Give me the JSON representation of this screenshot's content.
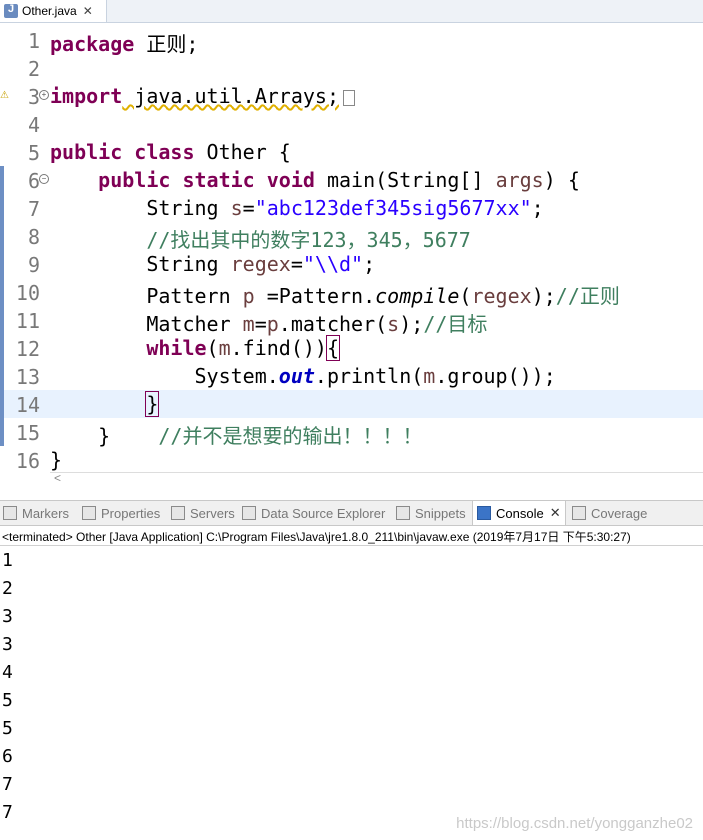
{
  "editor_tab": {
    "title": "Other.java",
    "close": "✕"
  },
  "code": {
    "l1_kw": "package",
    "l1_rest": " 正则;",
    "l3_kw": "import",
    "l3_rest": " java.util.Arrays;",
    "l5_kw1": "public",
    "l5_kw2": "class",
    "l5_rest": " Other {",
    "l6_kw1": "public",
    "l6_kw2": "static",
    "l6_kw3": "void",
    "l6_a": " main(String[] ",
    "l6_var": "args",
    "l6_b": ") {",
    "l7_a": "String ",
    "l7_var": "s",
    "l7_b": "=",
    "l7_str": "\"abc123def345sig5677xx\"",
    "l7_c": ";",
    "l8_cm": "//找出其中的数字123，345，5677",
    "l9_a": "String ",
    "l9_var": "regex",
    "l9_b": "=",
    "l9_str": "\"\\\\d\"",
    "l9_c": ";",
    "l10_a": "Pattern ",
    "l10_var": "p",
    "l10_b": " =Pattern.",
    "l10_it": "compile",
    "l10_c": "(",
    "l10_var2": "regex",
    "l10_d": ");",
    "l10_cm": "//正则",
    "l11_a": "Matcher ",
    "l11_var": "m",
    "l11_b": "=",
    "l11_var2": "p",
    "l11_c": ".matcher(",
    "l11_var3": "s",
    "l11_d": ");",
    "l11_cm": "//目标",
    "l12_kw": "while",
    "l12_a": "(",
    "l12_var": "m",
    "l12_b": ".find())",
    "l12_c": "{",
    "l13_a": "System.",
    "l13_fld": "out",
    "l13_b": ".println(",
    "l13_var": "m",
    "l13_c": ".group());",
    "l14_a": "}",
    "l15_a": "}    ",
    "l15_cm": "//并不是想要的输出！！！！",
    "l16_a": "}"
  },
  "line_numbers": [
    "1",
    "2",
    "3",
    "4",
    "5",
    "6",
    "7",
    "8",
    "9",
    "10",
    "11",
    "12",
    "13",
    "14",
    "15",
    "16"
  ],
  "scroll_arrow": "<",
  "view_tabs": [
    {
      "label": "Markers"
    },
    {
      "label": "Properties"
    },
    {
      "label": "Servers"
    },
    {
      "label": "Data Source Explorer"
    },
    {
      "label": "Snippets"
    },
    {
      "label": "Console",
      "close": "✕"
    },
    {
      "label": "Coverage"
    }
  ],
  "console": {
    "status": "<terminated> Other [Java Application] C:\\Program Files\\Java\\jre1.8.0_211\\bin\\javaw.exe (2019年7月17日 下午5:30:27)",
    "output": [
      "1",
      "2",
      "3",
      "3",
      "4",
      "5",
      "5",
      "6",
      "7",
      "7"
    ]
  },
  "watermark": "https://blog.csdn.net/yongganzhe02"
}
